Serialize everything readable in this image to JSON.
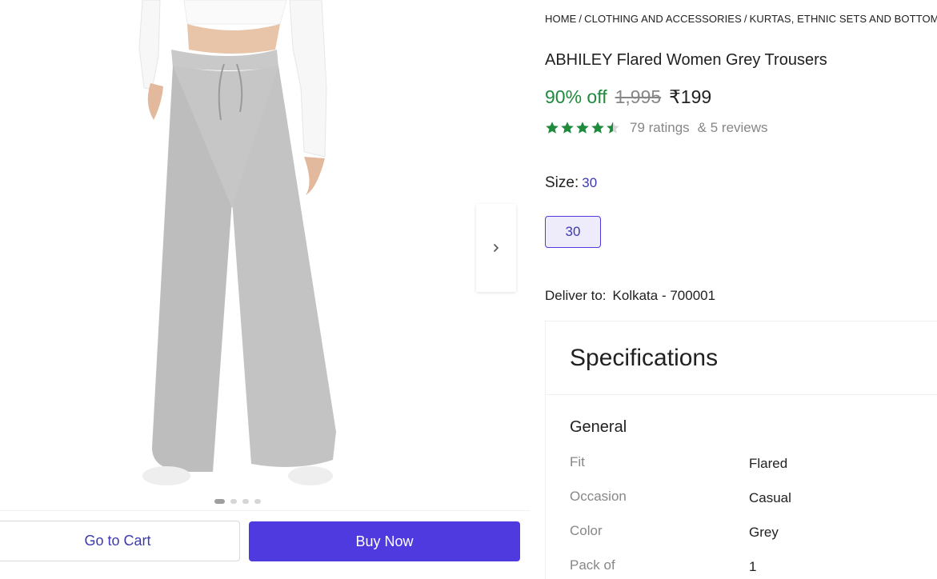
{
  "breadcrumb": {
    "items": [
      "HOME",
      "CLOTHING AND ACCESSORIES",
      "KURTAS, ETHNIC SETS AND BOTTOMS"
    ],
    "separator": "/"
  },
  "product": {
    "title": "ABHILEY Flared Women Grey Trousers",
    "discount": "90% off",
    "mrp": "1,995",
    "price": "₹199",
    "rating_value": 4.5,
    "ratings": "79 ratings",
    "reviews": "& 5 reviews"
  },
  "size": {
    "label": "Size:",
    "selected": "30",
    "options": [
      "30"
    ]
  },
  "delivery": {
    "label": "Deliver to:",
    "location": "Kolkata - 700001"
  },
  "specifications": {
    "heading": "Specifications",
    "group": "General",
    "rows": [
      {
        "key": "Fit",
        "value": "Flared"
      },
      {
        "key": "Occasion",
        "value": "Casual"
      },
      {
        "key": "Color",
        "value": "Grey"
      },
      {
        "key": "Pack of",
        "value": "1"
      }
    ]
  },
  "gallery": {
    "image_count": 4,
    "active_index": 0,
    "next_icon": "chevron-right-icon"
  },
  "actions": {
    "cart_label": "Go to Cart",
    "buy_label": "Buy Now"
  },
  "colors": {
    "accent": "#4f3ae0",
    "discount_green": "#1e8a3c",
    "star_green": "#1e8a3c"
  }
}
